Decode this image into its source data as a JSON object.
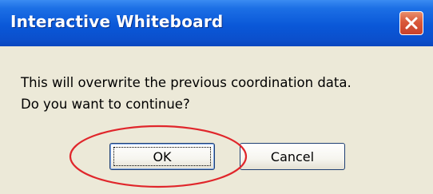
{
  "window": {
    "title": "Interactive Whiteboard"
  },
  "message": {
    "line1": "This will overwrite the previous coordination data.",
    "line2": "Do you want to continue?"
  },
  "buttons": {
    "ok_label": "OK",
    "cancel_label": "Cancel"
  },
  "icons": {
    "close": "close-icon"
  },
  "colors": {
    "titlebar": "#0a58d8",
    "close_button": "#d9583a",
    "dialog_background": "#ece9d8",
    "annotation_circle": "#e0262b"
  }
}
